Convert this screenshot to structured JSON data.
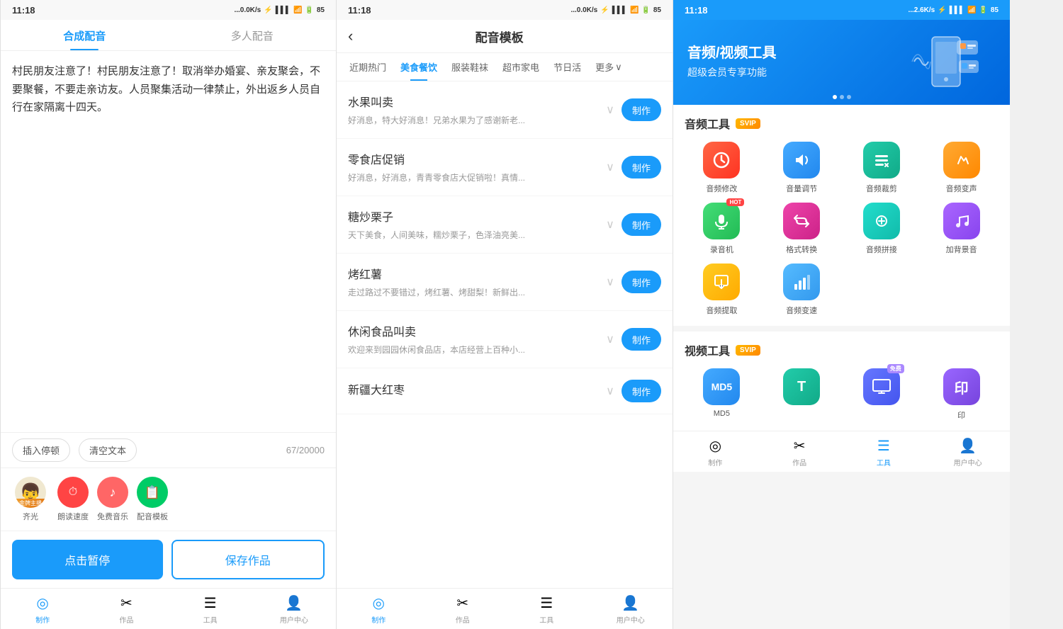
{
  "panel1": {
    "status": {
      "time": "11:18",
      "network": "...0.0K/s",
      "battery": "85"
    },
    "tabs": [
      "合成配音",
      "多人配音"
    ],
    "activeTab": 0,
    "textContent": "村民朋友注意了！村民朋友注意了！取消举办婚宴、亲友聚会，不要聚餐，不要走亲访友。人员聚集活动一律禁止，外出返乡人员自行在家隔离十四天。",
    "charCount": "67/20000",
    "toolbar": {
      "insert": "插入停顿",
      "clear": "清空文本"
    },
    "voices": [
      {
        "name": "齐光",
        "icon": "👦",
        "badge": "金牌主播",
        "type": "avatar"
      },
      {
        "name": "朗读速度",
        "icon": "🔴",
        "type": "speed"
      },
      {
        "name": "免费音乐",
        "icon": "🔴",
        "type": "music"
      },
      {
        "name": "配音模板",
        "icon": "📋",
        "type": "template"
      }
    ],
    "buttons": {
      "pause": "点击暂停",
      "save": "保存作品"
    },
    "nav": [
      {
        "label": "制作",
        "icon": "◎",
        "active": true
      },
      {
        "label": "作品",
        "icon": "✂"
      },
      {
        "label": "工具",
        "icon": "☰"
      },
      {
        "label": "用户中心",
        "icon": "👤"
      }
    ]
  },
  "panel2": {
    "status": {
      "time": "11:18",
      "network": "...0.0K/s",
      "battery": "85"
    },
    "title": "配音模板",
    "categories": [
      "近期热门",
      "美食餐饮",
      "服装鞋袜",
      "超市家电",
      "节日活",
      "更多"
    ],
    "activeCategory": 1,
    "templates": [
      {
        "title": "水果叫卖",
        "desc": "好消息，特大好消息！兄弟水果为了感谢新老..."
      },
      {
        "title": "零食店促销",
        "desc": "好消息，好消息，青青零食店大促销啦！真情..."
      },
      {
        "title": "糖炒栗子",
        "desc": "天下美食，人间美味，糯炒栗子，色泽油亮美..."
      },
      {
        "title": "烤红薯",
        "desc": "走过路过不要错过，烤红薯、烤甜梨！新鲜出..."
      },
      {
        "title": "休闲食品叫卖",
        "desc": "欢迎来到园园休闲食品店，本店经营上百种小..."
      },
      {
        "title": "新疆大红枣",
        "desc": ""
      }
    ],
    "makeLabel": "制作",
    "nav": [
      {
        "label": "制作",
        "icon": "◎",
        "active": true
      },
      {
        "label": "作品",
        "icon": "✂"
      },
      {
        "label": "工具",
        "icon": "☰"
      },
      {
        "label": "用户中心",
        "icon": "👤"
      }
    ]
  },
  "panel3": {
    "status": {
      "time": "11:18",
      "network": "...2.6K/s",
      "battery": "85"
    },
    "banner": {
      "line1": "音频/视频工具",
      "line2": "超级会员专享功能"
    },
    "audioSection": {
      "title": "音频工具",
      "badge": "SVIP",
      "tools": [
        {
          "label": "音频修改",
          "icon": "🔄",
          "color": "bg-red"
        },
        {
          "label": "音量调节",
          "icon": "🔊",
          "color": "bg-blue"
        },
        {
          "label": "音频裁剪",
          "icon": "✂",
          "color": "bg-teal"
        },
        {
          "label": "音频变声",
          "icon": "♪",
          "color": "bg-orange"
        },
        {
          "label": "录音机",
          "icon": "🎙",
          "color": "bg-green",
          "badge": "HOT"
        },
        {
          "label": "格式转换",
          "icon": "🔃",
          "color": "bg-pink"
        },
        {
          "label": "音频拼接",
          "icon": "⚙",
          "color": "bg-cyan"
        },
        {
          "label": "加背景音",
          "icon": "🎵",
          "color": "bg-purple"
        },
        {
          "label": "音频提取",
          "icon": "📁",
          "color": "bg-amber"
        },
        {
          "label": "音频变速",
          "icon": "📊",
          "color": "bg-lightblue"
        }
      ]
    },
    "videoSection": {
      "title": "视频工具",
      "badge": "SVIP",
      "tools": [
        {
          "label": "MD5",
          "icon": "M",
          "color": "bg-blue"
        },
        {
          "label": "",
          "icon": "T",
          "color": "bg-teal"
        },
        {
          "label": "",
          "icon": "🖥",
          "color": "bg-indigo",
          "badge": "免费"
        },
        {
          "label": "印",
          "icon": "印",
          "color": "bg-violet"
        }
      ]
    },
    "nav": [
      {
        "label": "制作",
        "icon": "◎"
      },
      {
        "label": "作品",
        "icon": "✂"
      },
      {
        "label": "工具",
        "icon": "☰",
        "active": true
      },
      {
        "label": "用户中心",
        "icon": "👤"
      }
    ]
  }
}
